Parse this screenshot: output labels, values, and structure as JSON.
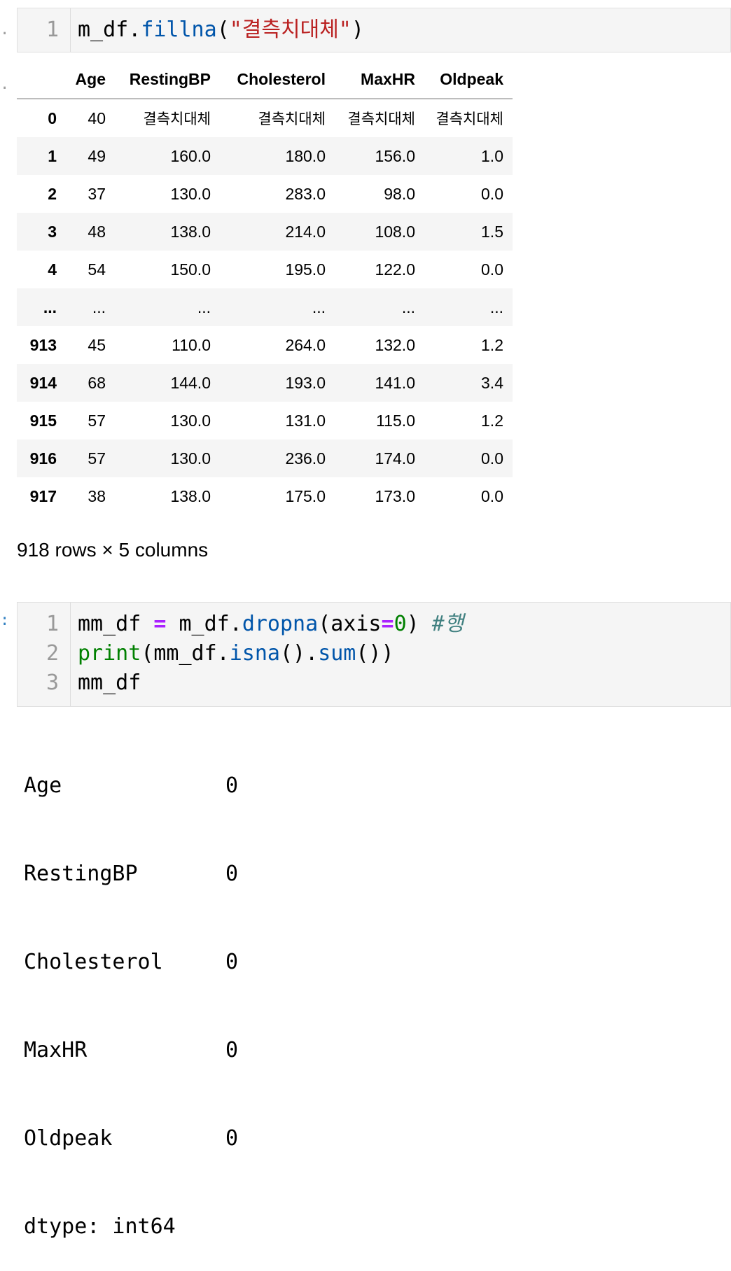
{
  "cell1": {
    "line_numbers": [
      "1"
    ],
    "code": {
      "var": "m_df",
      "dot": ".",
      "method": "fillna",
      "open": "(",
      "arg": "\"결측치대체\"",
      "close": ")"
    }
  },
  "dataframe": {
    "columns": [
      "",
      "Age",
      "RestingBP",
      "Cholesterol",
      "MaxHR",
      "Oldpeak"
    ],
    "rows": [
      [
        "0",
        "40",
        "결측치대체",
        "결측치대체",
        "결측치대체",
        "결측치대체"
      ],
      [
        "1",
        "49",
        "160.0",
        "180.0",
        "156.0",
        "1.0"
      ],
      [
        "2",
        "37",
        "130.0",
        "283.0",
        "98.0",
        "0.0"
      ],
      [
        "3",
        "48",
        "138.0",
        "214.0",
        "108.0",
        "1.5"
      ],
      [
        "4",
        "54",
        "150.0",
        "195.0",
        "122.0",
        "0.0"
      ],
      [
        "...",
        "...",
        "...",
        "...",
        "...",
        "..."
      ],
      [
        "913",
        "45",
        "110.0",
        "264.0",
        "132.0",
        "1.2"
      ],
      [
        "914",
        "68",
        "144.0",
        "193.0",
        "141.0",
        "3.4"
      ],
      [
        "915",
        "57",
        "130.0",
        "131.0",
        "115.0",
        "1.2"
      ],
      [
        "916",
        "57",
        "130.0",
        "236.0",
        "174.0",
        "0.0"
      ],
      [
        "917",
        "38",
        "138.0",
        "175.0",
        "173.0",
        "0.0"
      ]
    ],
    "shape_text": "918 rows × 5 columns"
  },
  "cell2": {
    "prompt_marker": ":",
    "line_numbers": [
      "1",
      "2",
      "3"
    ],
    "line1": {
      "a": "mm_df ",
      "op": "=",
      "b": " m_df.",
      "method": "dropna",
      "c": "(axis",
      "op2": "=",
      "num": "0",
      "d": ") ",
      "comment": "#행"
    },
    "line2": {
      "builtin": "print",
      "a": "(mm_df.",
      "m1": "isna",
      "b": "().",
      "m2": "sum",
      "c": "())"
    },
    "line3": "mm_df"
  },
  "stdout": {
    "rows": [
      {
        "key": "Age",
        "value": "0"
      },
      {
        "key": "RestingBP",
        "value": "0"
      },
      {
        "key": "Cholesterol",
        "value": "0"
      },
      {
        "key": "MaxHR",
        "value": "0"
      },
      {
        "key": "Oldpeak",
        "value": "0"
      }
    ],
    "dtype_line": "dtype: int64"
  }
}
